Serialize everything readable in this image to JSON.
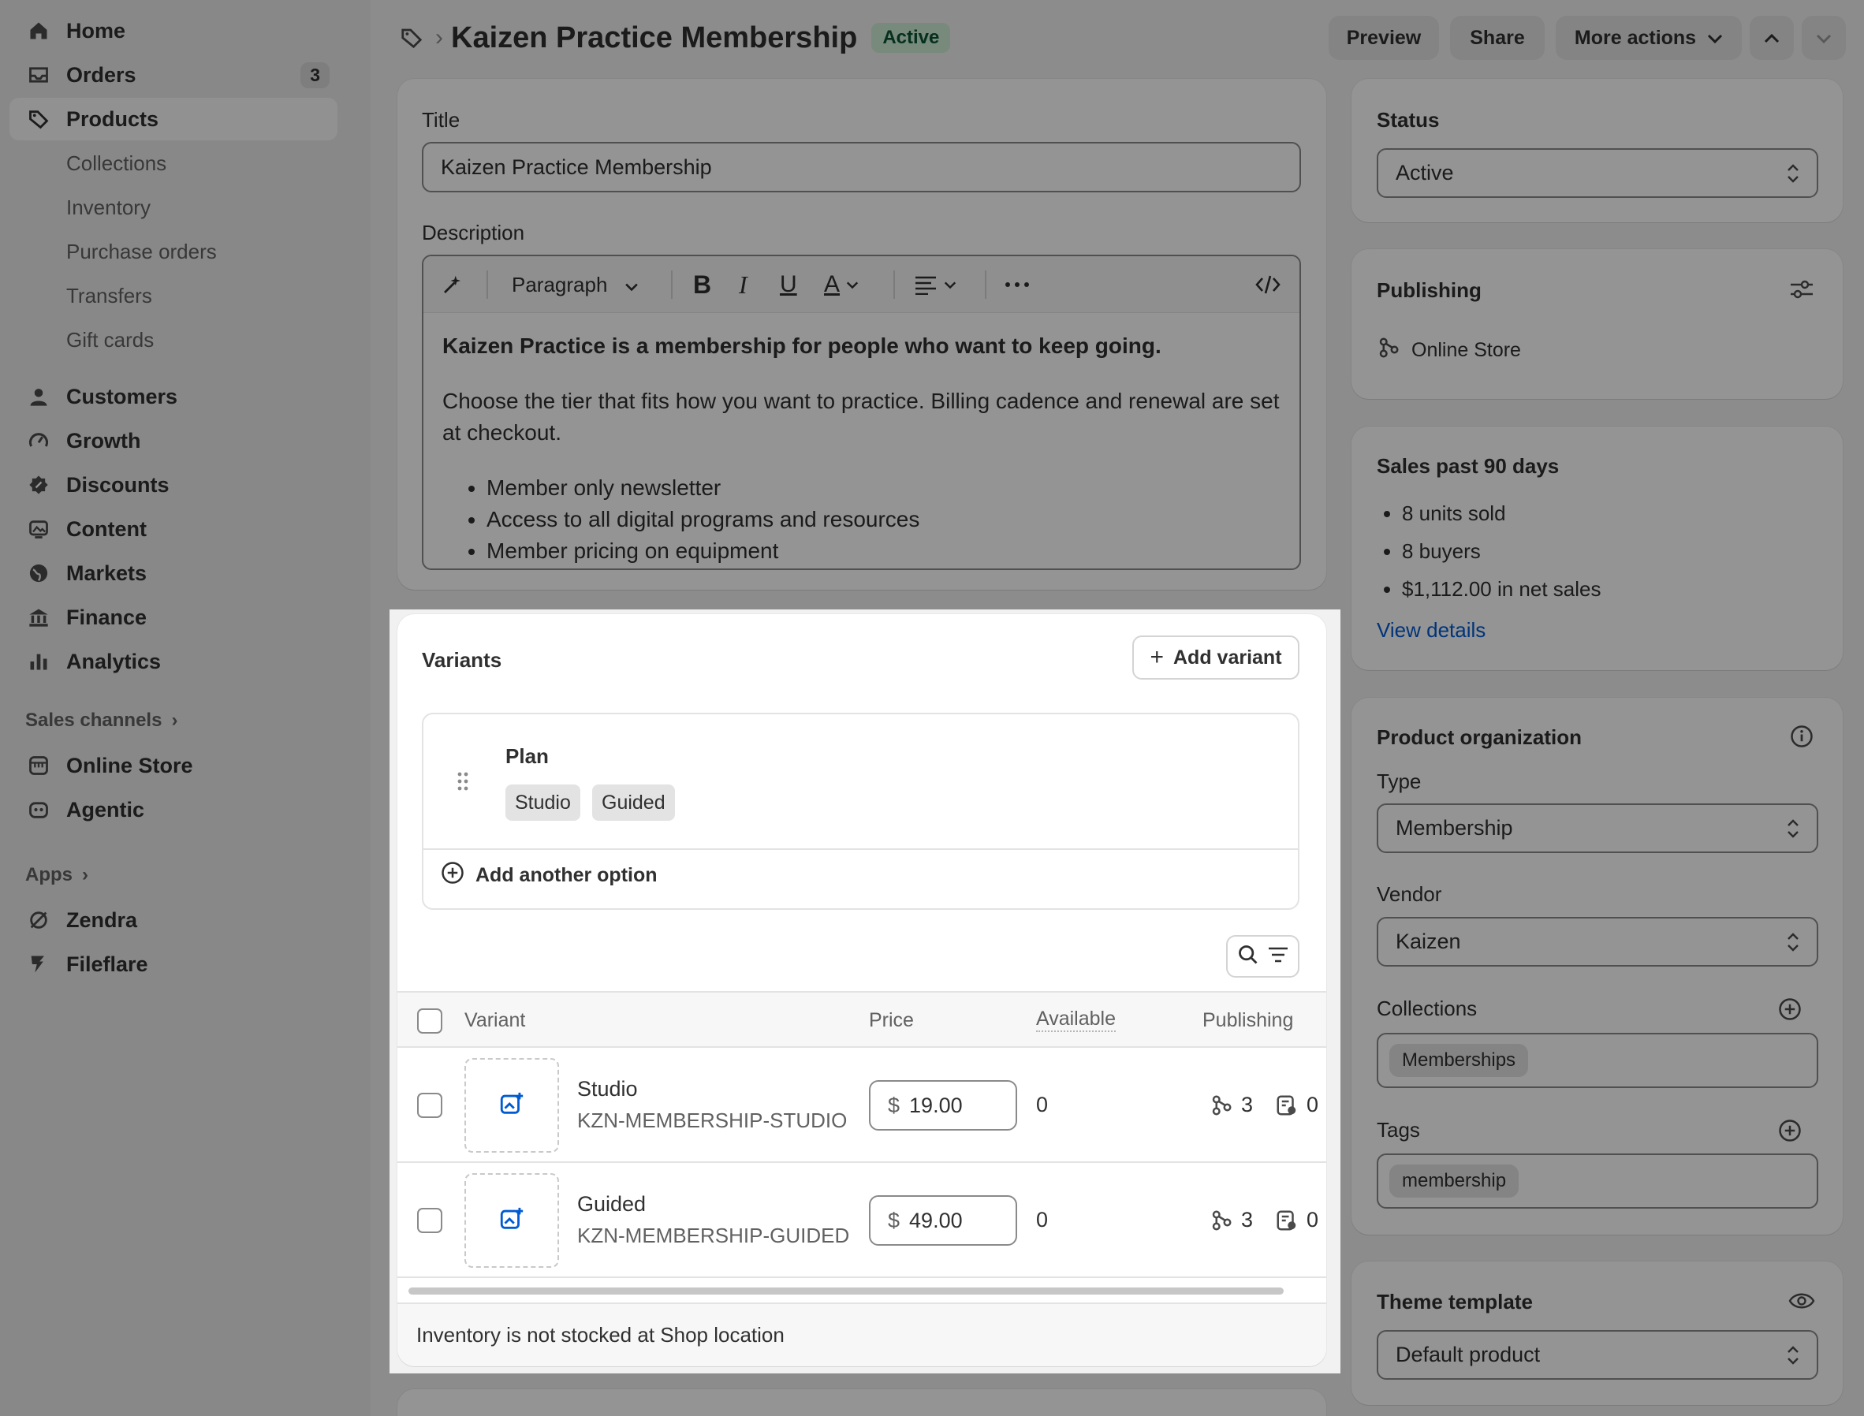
{
  "sidebar": {
    "main_items": [
      {
        "label": "Home",
        "icon": "home-icon"
      },
      {
        "label": "Orders",
        "icon": "inbox-icon",
        "badge": "3"
      },
      {
        "label": "Products",
        "icon": "tag-icon"
      }
    ],
    "product_sub_items": [
      "Collections",
      "Inventory",
      "Purchase orders",
      "Transfers",
      "Gift cards"
    ],
    "more_items": [
      {
        "label": "Customers",
        "icon": "person-icon"
      },
      {
        "label": "Growth",
        "icon": "gauge-icon"
      },
      {
        "label": "Discounts",
        "icon": "discount-icon"
      },
      {
        "label": "Content",
        "icon": "image-icon"
      },
      {
        "label": "Markets",
        "icon": "globe-icon"
      },
      {
        "label": "Finance",
        "icon": "bank-icon"
      },
      {
        "label": "Analytics",
        "icon": "bar-chart-icon"
      }
    ],
    "sales_channels_label": "Sales channels",
    "sales_channels": [
      {
        "label": "Online Store",
        "icon": "store-icon"
      },
      {
        "label": "Agentic",
        "icon": "robot-icon"
      }
    ],
    "apps_label": "Apps",
    "apps": [
      {
        "label": "Zendra",
        "icon": "zendra-icon"
      },
      {
        "label": "Fileflare",
        "icon": "fileflare-icon"
      }
    ]
  },
  "header": {
    "title": "Kaizen Practice Membership",
    "status": "Active",
    "preview": "Preview",
    "share": "Share",
    "more_actions": "More actions"
  },
  "product": {
    "title_label": "Title",
    "title_value": "Kaizen Practice Membership",
    "description_label": "Description",
    "toolbar_paragraph": "Paragraph",
    "description_bold": "Kaizen Practice is a membership for people who want to keep going.",
    "description_text": "Choose the tier that fits how you want to practice. Billing cadence and renewal are set at checkout.",
    "description_bullets": [
      "Member only newsletter",
      "Access to all digital programs and resources",
      "Member pricing on equipment"
    ]
  },
  "variants": {
    "heading": "Variants",
    "add_variant": "Add variant",
    "option_name": "Plan",
    "option_values": [
      "Studio",
      "Guided"
    ],
    "add_another_option": "Add another option",
    "columns": {
      "variant": "Variant",
      "price": "Price",
      "available": "Available",
      "publishing": "Publishing"
    },
    "rows": [
      {
        "name": "Studio",
        "sku": "KZN-MEMBERSHIP-STUDIO",
        "currency": "$",
        "price": "19.00",
        "available": "0",
        "channels": "3",
        "catalogs": "0"
      },
      {
        "name": "Guided",
        "sku": "KZN-MEMBERSHIP-GUIDED",
        "currency": "$",
        "price": "49.00",
        "available": "0",
        "channels": "3",
        "catalogs": "0"
      }
    ],
    "footer": "Inventory is not stocked at Shop location"
  },
  "status_card": {
    "heading": "Status",
    "value": "Active"
  },
  "publishing_card": {
    "heading": "Publishing",
    "channel": "Online Store"
  },
  "sales_card": {
    "heading": "Sales past 90 days",
    "items": [
      "8 units sold",
      "8 buyers",
      "$1,112.00 in net sales"
    ],
    "link": "View details"
  },
  "organization": {
    "heading": "Product organization",
    "type_label": "Type",
    "type_value": "Membership",
    "vendor_label": "Vendor",
    "vendor_value": "Kaizen",
    "collections_label": "Collections",
    "collection_chip": "Memberships",
    "tags_label": "Tags",
    "tag_chip": "membership"
  },
  "theme_card": {
    "heading": "Theme template",
    "value": "Default product"
  },
  "colors": {
    "accent_link": "#005bd3",
    "status_green_bg": "#cdeed5",
    "overlay": "rgba(0,0,0,0.42)"
  }
}
